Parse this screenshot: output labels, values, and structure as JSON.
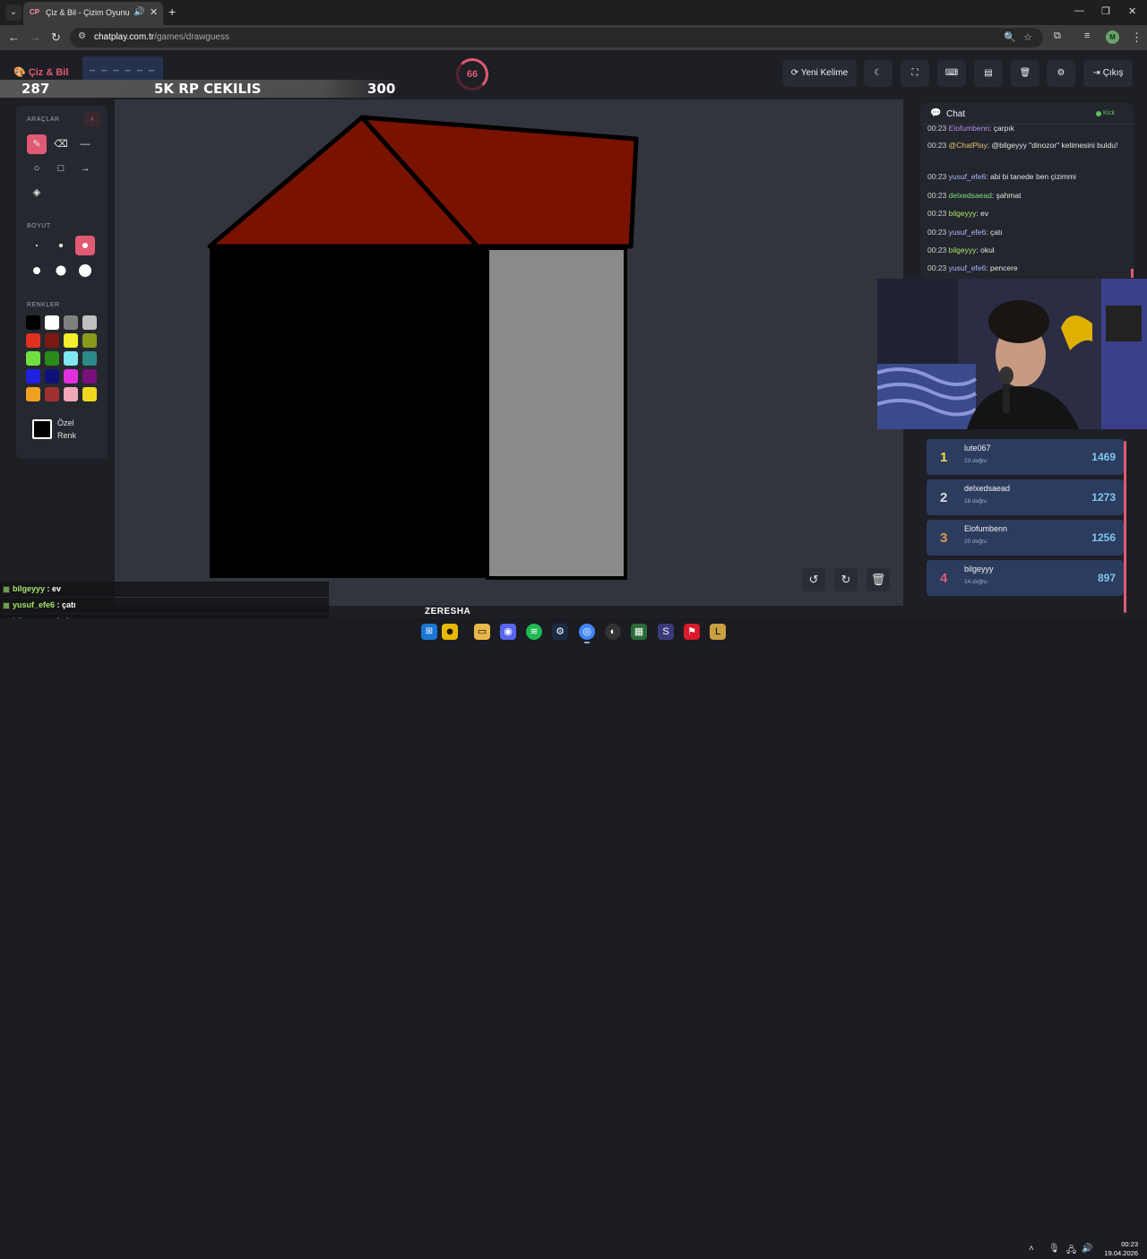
{
  "browser": {
    "tab_title": "Çiz & Bil - Çizim Oyunu",
    "tab_favicon": "CP",
    "url_host": "chatplay.com.tr",
    "url_path": "/games/drawguess",
    "profile_initial": "M"
  },
  "header": {
    "logo": "Çiz & Bil",
    "word_hint": "_ _ _ _ _ _",
    "timer": "66",
    "new_word_label": "Yeni Kelime",
    "logout_label": "Çıkış"
  },
  "promo": {
    "left_number": "287",
    "title": "5K RP CEKILIS",
    "right_number": "300"
  },
  "tools": {
    "tools_label": "ARAÇLAR",
    "size_label": "BOYUT",
    "colors_label": "RENKLER",
    "custom_color_label": "Özel Renk",
    "colors": [
      "#000000",
      "#ffffff",
      "#808080",
      "#c0c0c0",
      "#e03020",
      "#7a1a10",
      "#f2ee2a",
      "#8a9a1a",
      "#70e040",
      "#2a8a1a",
      "#80e8f0",
      "#2a8a8a",
      "#2020e0",
      "#10107a",
      "#e030e0",
      "#7a107a",
      "#f0a020",
      "#a03030",
      "#f0a8b8",
      "#f0d820"
    ]
  },
  "chat": {
    "title": "Chat",
    "platform": "Kick",
    "messages": [
      {
        "time": "00:23",
        "user": "Elofumbenn",
        "text": ": çarpık",
        "color": "#b48ff0"
      },
      {
        "time": "00:23",
        "user": "@ChatPlay",
        "text": ": @bilgeyyy \"dinozor\" kelimesini buldu!",
        "color": "#e8c26a"
      },
      {
        "time": "00:23",
        "user": "yusuf_efe6",
        "text": ": abi bi tanede ben çizimmi",
        "color": "#a9b6ff"
      },
      {
        "time": "00:23",
        "user": "delxedsaead",
        "text": ": şahmat",
        "color": "#7fe07f"
      },
      {
        "time": "00:23",
        "user": "bilgeyyy",
        "text": ": ev",
        "color": "#a7e36a"
      },
      {
        "time": "00:23",
        "user": "yusuf_efe6",
        "text": ": çatı",
        "color": "#a9b6ff"
      },
      {
        "time": "00:23",
        "user": "bilgeyyy",
        "text": ": okul",
        "color": "#a7e36a"
      },
      {
        "time": "00:23",
        "user": "yusuf_efe6",
        "text": ": pencere",
        "color": "#a9b6ff"
      }
    ]
  },
  "leaderboard": [
    {
      "rank": "1",
      "name": "lute067",
      "sub": "23 doğru",
      "score": "1469",
      "rank_color": "#f2d64a"
    },
    {
      "rank": "2",
      "name": "delxedsaead",
      "sub": "18 doğru",
      "score": "1273",
      "rank_color": "#d8dce6"
    },
    {
      "rank": "3",
      "name": "Elofumbenn",
      "sub": "20 doğru",
      "score": "1256",
      "rank_color": "#e0964a"
    },
    {
      "rank": "4",
      "name": "bilgeyyy",
      "sub": "14 doğru",
      "score": "897",
      "rank_color": "#e05a74"
    }
  ],
  "overlay_chat": [
    {
      "user": "bilgeyyy",
      "text": " : ev"
    },
    {
      "user": "yusuf_efe6",
      "text": " : çatı"
    },
    {
      "user": "bilgeyyy",
      "text": " : okul"
    },
    {
      "user": "yusuf_efe6",
      "text": " : pencere"
    }
  ],
  "taskbar": {
    "streamer_tag": "ZERESHA",
    "time": "00:23",
    "date": "19.04.2026"
  },
  "colors": {
    "accent": "#e05a74",
    "roof": "#7a1200",
    "wall": "#000000",
    "window": "#8a8a8a"
  }
}
